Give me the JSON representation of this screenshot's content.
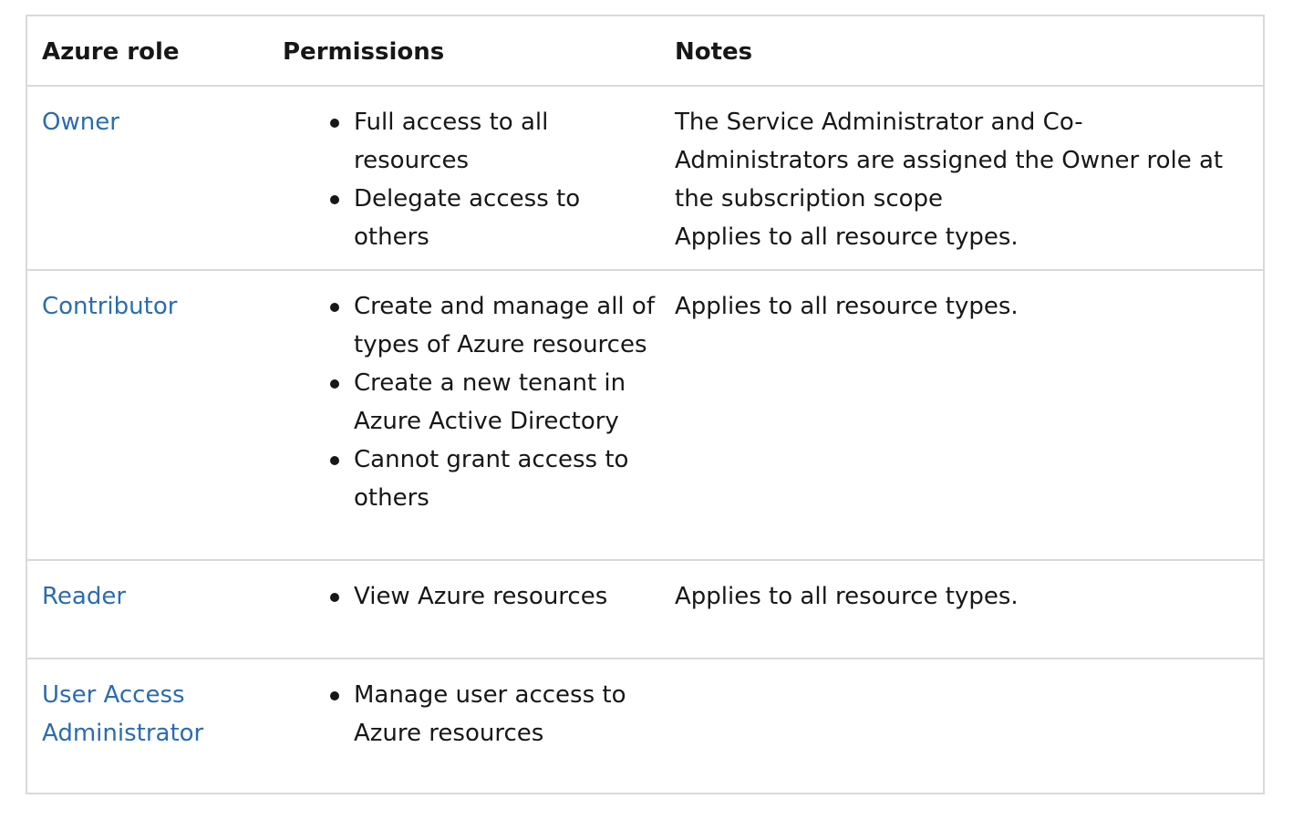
{
  "table": {
    "headers": {
      "role": "Azure role",
      "permissions": "Permissions",
      "notes": "Notes"
    },
    "rows": [
      {
        "role": "Owner",
        "permissions": [
          "Full access to all resources",
          "Delegate access to others"
        ],
        "notes": [
          "The Service Administrator and Co-Administrators are assigned the Owner role at the subscription scope",
          "Applies to all resource types."
        ]
      },
      {
        "role": "Contributor",
        "permissions": [
          "Create and manage all of types of Azure resources",
          "Create a new tenant in Azure Active Directory",
          "Cannot grant access to others"
        ],
        "notes": [
          "Applies to all resource types."
        ]
      },
      {
        "role": "Reader",
        "permissions": [
          "View Azure resources"
        ],
        "notes": [
          "Applies to all resource types."
        ]
      },
      {
        "role": "User Access Administrator",
        "permissions": [
          "Manage user access to Azure resources"
        ],
        "notes": []
      }
    ]
  },
  "colors": {
    "link": "#2b6cb0",
    "text": "#171717",
    "border": "#d9d9d9"
  }
}
